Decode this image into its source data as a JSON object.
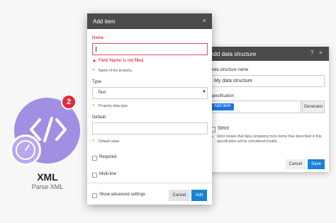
{
  "module": {
    "badge_count": "2",
    "name": "XML",
    "subtitle": "Parse XML"
  },
  "data_structure_dialog": {
    "title": "Add data structure",
    "help_icon": "?",
    "close_icon": "×",
    "name_label": "Data structure name",
    "name_value": "My data structure",
    "spec_label": "Specification",
    "add_item_label": "Add item",
    "generator_label": "Generator",
    "strict_label": "Strict",
    "strict_hint": "Strict means that data containing more items than described in this specification will be considered invalid.",
    "cancel_label": "Cancel",
    "save_label": "Save"
  },
  "add_item_dialog": {
    "title": "Add item",
    "close_icon": "×",
    "name_label": "Name",
    "name_value": "",
    "name_error": "Field 'Name' is not filled.",
    "name_hint": "Name of the property.",
    "type_label": "Type",
    "type_value": "Text",
    "type_hint": "Property data type.",
    "default_label": "Default",
    "default_value": "",
    "default_hint": "Default value.",
    "required_label": "Required",
    "multiline_label": "Multi-line",
    "advanced_label": "Show advanced settings",
    "cancel_label": "Cancel",
    "add_label": "Add"
  },
  "colors": {
    "accent": "#1a82d8",
    "error": "#d0021b",
    "header": "#4a4a4a",
    "module": "#a18fe3",
    "badge": "#e5283b"
  },
  "icons": {
    "module": "code-brackets-icon",
    "clock": "clock-icon",
    "hint": "lightbulb-icon",
    "error": "warning-icon"
  }
}
